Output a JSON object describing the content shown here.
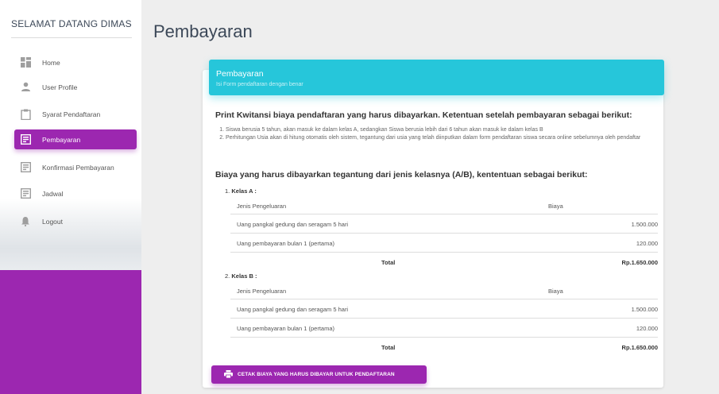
{
  "sidebar": {
    "brand": "SELAMAT DATANG DIMAS",
    "items": [
      {
        "label": "Home",
        "icon": "dashboard-icon"
      },
      {
        "label": "User Profile",
        "icon": "person-icon"
      },
      {
        "label": "Syarat Pendaftaran",
        "icon": "clipboard-icon"
      },
      {
        "label": "Pembayaran",
        "icon": "form-icon",
        "active": true
      },
      {
        "label": "Konfirmasi Pembayaran",
        "icon": "form-icon"
      },
      {
        "label": "Jadwal",
        "icon": "form-icon"
      },
      {
        "label": "Logout",
        "icon": "bell-icon"
      }
    ],
    "accent": "#9c27b0"
  },
  "page": {
    "title": "Pembayaran"
  },
  "card": {
    "header_title": "Pembayaran",
    "header_subtitle": "Isi Form pendaftaran dengan benar",
    "header_color": "#26c6da",
    "intro": "Print Kwitansi biaya pendaftaran yang harus dibayarkan. Ketentuan setelah pembayaran sebagai berikut:",
    "rules": [
      "Siswa berusia 5 tahun, akan masuk ke dalam kelas A, sedangkan Siswa berusia lebih dari 6 tahun akan masuk ke dalam kelas B",
      "Perhitungan Usia akan di hitung otomatis oleh sistem, tegantung dari usia yang telah diinputkan dalam form pendaftaran siswa secara online sebelumnya oleh pendaftar"
    ],
    "section_title": "Biaya yang harus dibayarkan tegantung dari jenis kelasnya (A/B), kententuan sebagai berikut:",
    "classes": [
      {
        "label": "Kelas A :",
        "number": "1.",
        "col_item": "Jenis Pengeluaran",
        "col_cost": "Biaya",
        "rows": [
          {
            "item": "Uang pangkal gedung dan seragam 5 hari",
            "cost": "1.500.000"
          },
          {
            "item": "Uang pembayaran bulan 1 (pertama)",
            "cost": "120.000"
          }
        ],
        "total_label": "Total",
        "total_value": "Rp.1.650.000"
      },
      {
        "label": "Kelas B :",
        "number": "2.",
        "col_item": "Jenis Pengeluaran",
        "col_cost": "Biaya",
        "rows": [
          {
            "item": "Uang pangkal gedung dan seragam 5 hari",
            "cost": "1.500.000"
          },
          {
            "item": "Uang pembayaran bulan 1 (pertama)",
            "cost": "120.000"
          }
        ],
        "total_label": "Total",
        "total_value": "Rp.1.650.000"
      }
    ],
    "print_button": "CETAK BIAYA YANG HARUS DIBAYAR UNTUK PENDAFTARAN"
  }
}
